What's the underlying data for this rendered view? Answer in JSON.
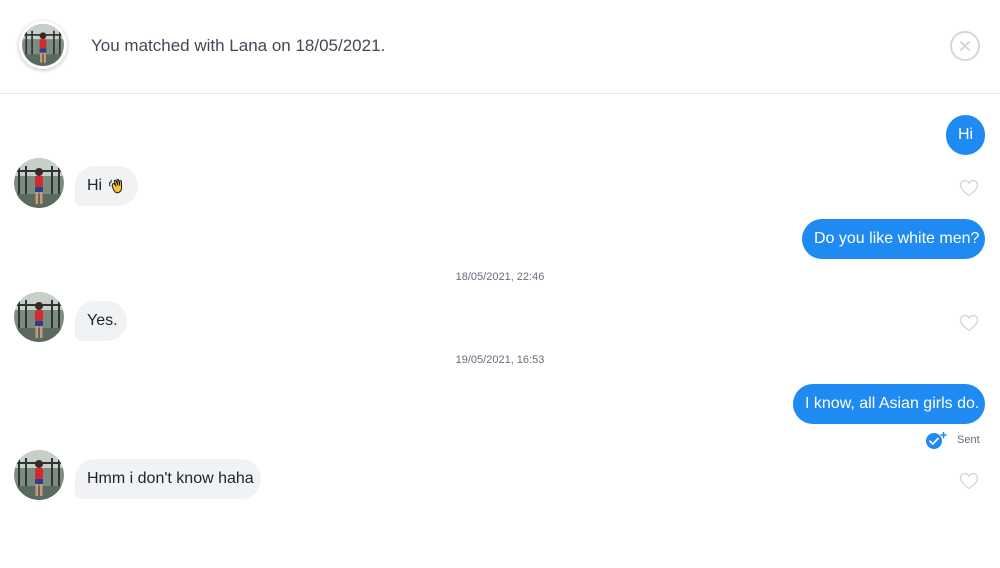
{
  "header": {
    "match_text": "You matched with Lana on 18/05/2021."
  },
  "messages": [
    {
      "dir": "out",
      "text": "Hi"
    },
    {
      "dir": "in",
      "text": "Hi",
      "emoji": "waving-hand-icon"
    },
    {
      "dir": "out",
      "text": "Do you like white men?"
    },
    {
      "dir": "in",
      "text": "Yes."
    },
    {
      "dir": "out",
      "text": "I know, all Asian girls do.",
      "status": "Sent"
    },
    {
      "dir": "in",
      "text": "Hmm i don't know haha"
    }
  ],
  "timestamps": [
    "18/05/2021, 22:46",
    "19/05/2021, 16:53"
  ],
  "colors": {
    "outgoing_bubble": "#1f8af2",
    "incoming_bubble": "#f0f2f4",
    "status_icon": "#1f8af2"
  }
}
